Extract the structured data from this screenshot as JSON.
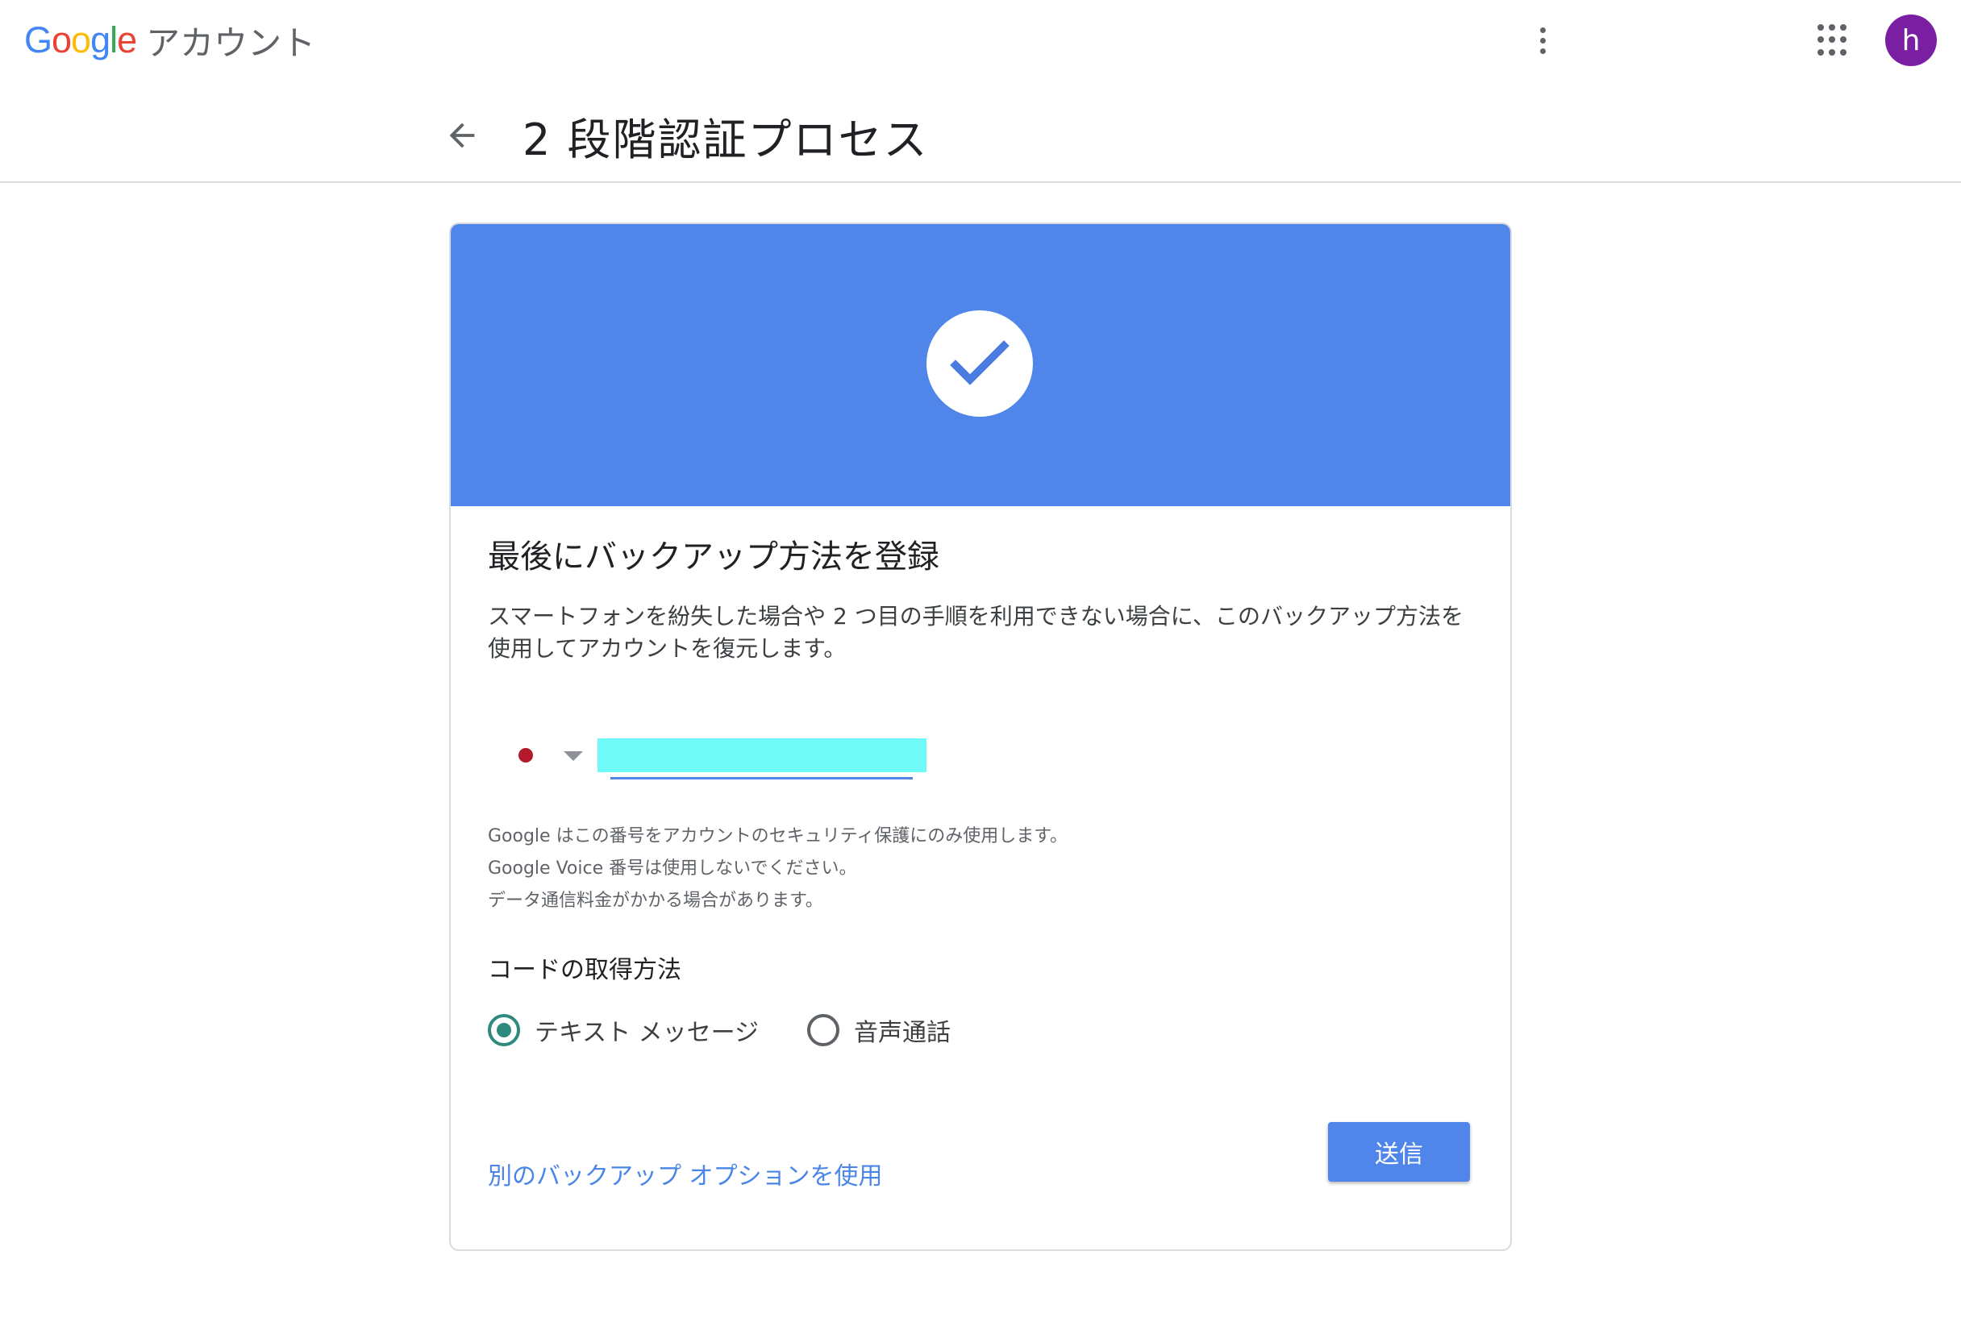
{
  "header": {
    "logo_letters": [
      {
        "char": "G",
        "color": "#4285f4"
      },
      {
        "char": "o",
        "color": "#ea4335"
      },
      {
        "char": "o",
        "color": "#fbbc05"
      },
      {
        "char": "g",
        "color": "#4285f4"
      },
      {
        "char": "l",
        "color": "#34a853"
      },
      {
        "char": "e",
        "color": "#ea4335"
      }
    ],
    "product_name": "アカウント",
    "menu_icon": "more-vert-icon",
    "apps_icon": "apps-grid-icon",
    "avatar_initial": "h",
    "avatar_color": "#7b1fa2"
  },
  "page": {
    "back_icon": "arrow-back-icon",
    "title": "2 段階認証プロセス"
  },
  "card": {
    "banner_color": "#5085ea",
    "banner_icon": "check-circle-icon",
    "heading": "最後にバックアップ方法を登録",
    "description": "スマートフォンを紛失した場合や 2 つ目の手順を利用できない場合に、このバックアップ方法を使用してアカウントを復元します。",
    "phone": {
      "country_flag_icon": "japan-flag-icon",
      "dropdown_icon": "caret-down-icon",
      "value": ""
    },
    "notes": [
      "Google はこの番号をアカウントのセキュリティ保護にのみ使用します。",
      "Google Voice 番号は使用しないでください。",
      "データ通信料金がかかる場合があります。"
    ],
    "method_label": "コードの取得方法",
    "methods": [
      {
        "label": "テキスト メッセージ",
        "selected": true
      },
      {
        "label": "音声通話",
        "selected": false
      }
    ],
    "alt_link": "別のバックアップ オプションを使用",
    "send_label": "送信"
  }
}
